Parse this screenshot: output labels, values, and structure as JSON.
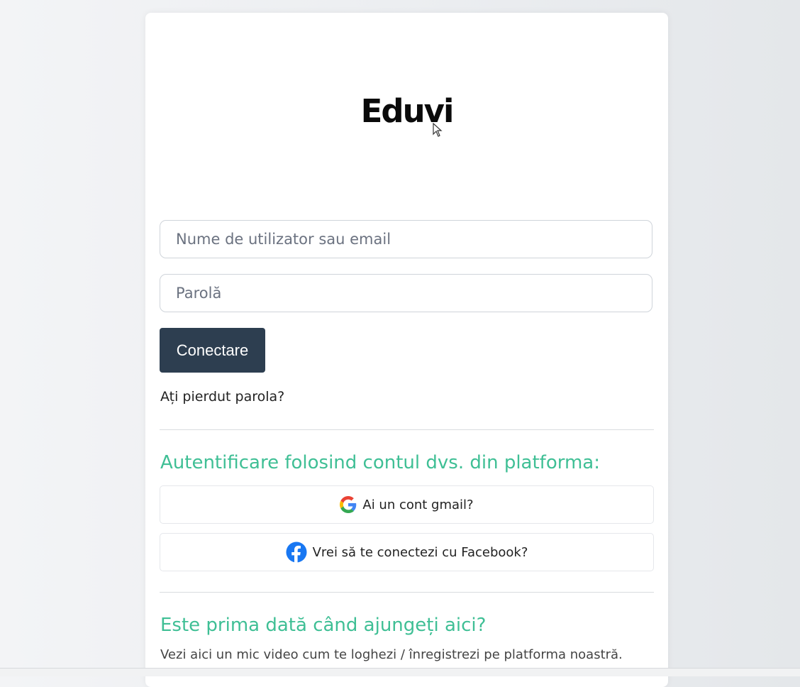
{
  "brand": {
    "logo_text": "Eduvi"
  },
  "login_form": {
    "username_placeholder": "Nume de utilizator sau email",
    "password_placeholder": "Parolă",
    "submit_label": "Conectare",
    "forgot_password": "Ați pierdut parola?"
  },
  "social_login": {
    "heading": "Autentificare folosind contul dvs. din platforma:",
    "google_label": "Ai un cont gmail?",
    "facebook_label": "Vrei să te conectezi cu Facebook?"
  },
  "first_time": {
    "heading": "Este prima dată când ajungeți aici?",
    "text": "Vezi aici un mic video cum te loghezi / înregistrezi pe platforma noastră."
  },
  "colors": {
    "accent_teal": "#3fbf95",
    "button_dark": "#2d3e50",
    "facebook_blue": "#1877f2"
  },
  "icons": {
    "google": "google-icon",
    "facebook": "facebook-icon",
    "cursor": "mouse-cursor-icon"
  }
}
